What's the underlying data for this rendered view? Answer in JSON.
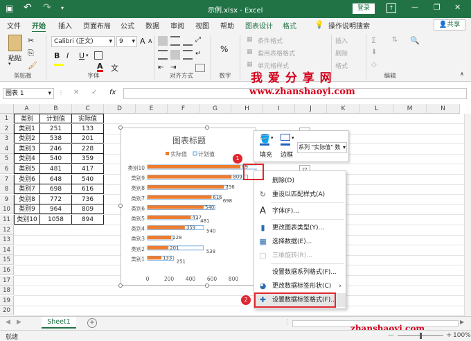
{
  "title_bar": {
    "doc_title": "示例.xlsx - Excel",
    "login": "登录",
    "min": "—",
    "restore": "❐",
    "close": "✕",
    "undo": "↶",
    "redo": "↷",
    "save": "💾"
  },
  "tabs": [
    "文件",
    "开始",
    "插入",
    "页面布局",
    "公式",
    "数据",
    "审阅",
    "视图",
    "帮助",
    "图表设计",
    "格式"
  ],
  "tell_me": "操作说明搜索",
  "share": "共享",
  "ribbon": {
    "paste": "粘贴",
    "font_name": "Calibri (正文)",
    "font_size": "9",
    "font_group": "字体",
    "align_group": "对齐方式",
    "clipboard_group": "剪贴板",
    "number_group": "数字",
    "cond_format": "条件格式",
    "table_format": "套用表格格式",
    "cell_style": "单元格样式",
    "insert": "插入",
    "delete": "删除",
    "format": "格式",
    "edit_group": "编辑",
    "bold": "B",
    "italic": "I",
    "underline": "U",
    "font_color": "A",
    "big_a": "A",
    "small_a": "A",
    "pct": "%",
    "wen": "文"
  },
  "watermark": {
    "title": "我 爱 分 享 网",
    "url": "www.zhanshaoyi.com",
    "bottom_url": "zhanshaoyi.com"
  },
  "name_box": "图表 1",
  "fx": "fx",
  "columns": [
    "A",
    "B",
    "C",
    "D",
    "E",
    "F",
    "G",
    "H",
    "I",
    "J",
    "K",
    "L",
    "M",
    "N"
  ],
  "rows": [
    "1",
    "2",
    "3",
    "4",
    "5",
    "6",
    "7",
    "8",
    "9",
    "10",
    "11",
    "12",
    "13",
    "14",
    "15",
    "16",
    "17",
    "18",
    "19",
    "20"
  ],
  "table": {
    "headers": [
      "类别",
      "计划值",
      "实际值"
    ],
    "rows": [
      [
        "类别1",
        "251",
        "133"
      ],
      [
        "类别2",
        "538",
        "201"
      ],
      [
        "类别3",
        "246",
        "228"
      ],
      [
        "类别4",
        "540",
        "359"
      ],
      [
        "类别5",
        "481",
        "417"
      ],
      [
        "类别6",
        "648",
        "540"
      ],
      [
        "类别7",
        "698",
        "616"
      ],
      [
        "类别8",
        "772",
        "736"
      ],
      [
        "类别9",
        "964",
        "809"
      ],
      [
        "类别10",
        "1058",
        "894"
      ]
    ]
  },
  "chart_data": {
    "type": "bar",
    "title": "图表标题",
    "categories": [
      "类别1",
      "类别2",
      "类别3",
      "类别4",
      "类别5",
      "类别6",
      "类别7",
      "类别8",
      "类别9",
      "类别10"
    ],
    "series": [
      {
        "name": "实际值",
        "values": [
          133,
          201,
          228,
          359,
          417,
          540,
          616,
          736,
          809,
          894
        ],
        "color": "#ed7d31"
      },
      {
        "name": "计划值",
        "values": [
          251,
          538,
          246,
          540,
          481,
          648,
          698,
          772,
          964,
          1058
        ],
        "color": "#5b9bd5"
      }
    ],
    "data_labels_actual": [
      "133",
      "201",
      "228",
      "359",
      "417",
      "540",
      "616",
      "736",
      "809",
      "89"
    ],
    "data_labels_plan": [
      "251",
      "538",
      "",
      "540",
      "481",
      "",
      "698",
      "",
      "",
      ""
    ],
    "xticks": [
      "0",
      "200",
      "400",
      "600",
      "800",
      "1"
    ],
    "xlim": [
      0,
      1000
    ],
    "legend": "top"
  },
  "mini_toolbar": {
    "fill": "填充",
    "outline": "边框",
    "series_select": "系列 \"实际值\" 数"
  },
  "context_menu": [
    "删除(D)",
    "重设以匹配样式(A)",
    "字体(F)...",
    "更改图表类型(Y)...",
    "选择数据(E)...",
    "三维旋转(R)...",
    "设置数据系列格式(F)...",
    "更改数据标签形状(C)",
    "设置数据标签格式(F)..."
  ],
  "badges": [
    "1",
    "2"
  ],
  "sheet_tab": "Sheet1",
  "add_sheet": "+",
  "status": "就绪",
  "zoom": "100%"
}
